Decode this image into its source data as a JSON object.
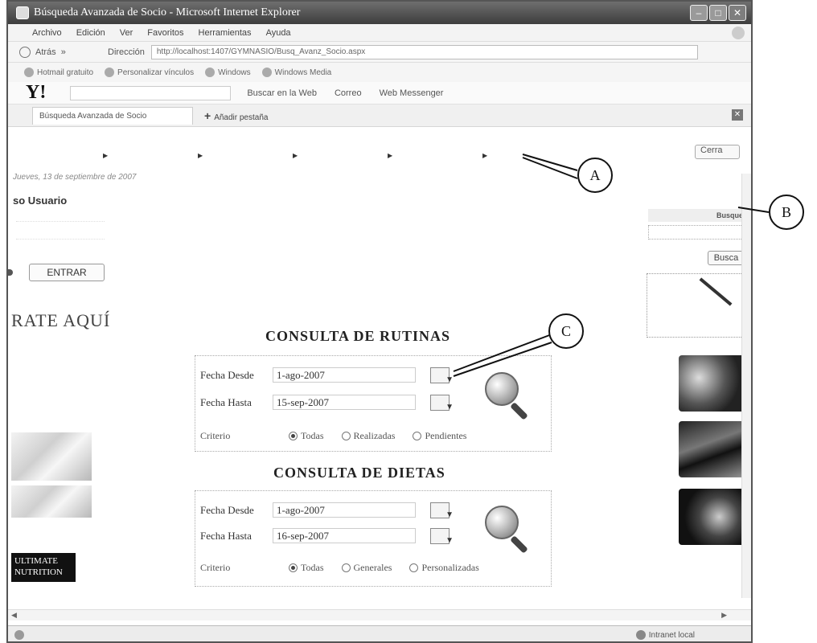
{
  "window": {
    "title": "Búsqueda Avanzada de Socio - Microsoft Internet Explorer"
  },
  "menu": [
    "Archivo",
    "Edición",
    "Ver",
    "Favoritos",
    "Herramientas",
    "Ayuda"
  ],
  "address": {
    "back_label": "Atrás",
    "address_label": "Dirección",
    "url": "http://localhost:1407/GYMNASIO/Busq_Avanz_Socio.aspx"
  },
  "links": [
    "Hotmail gratuito",
    "Personalizar vínculos",
    "Windows",
    "Windows Media"
  ],
  "yahoo_toolbar": {
    "logo": "Y!",
    "search_web": "Buscar en la Web",
    "mail": "Correo",
    "messenger": "Web Messenger"
  },
  "tabs": {
    "active_tab": "Búsqueda Avanzada de Socio",
    "new_tab": "Añadir pestaña"
  },
  "page": {
    "close_label": "Cerra",
    "date_text": "Jueves, 13 de septiembre de 2007",
    "user_title": "so Usuario",
    "login_button": "ENTRAR",
    "register_text": "RATE AQUÍ",
    "promo_dark_text": "ULTIMATE NUTRITION"
  },
  "consulta_rutinas": {
    "title": "CONSULTA DE RUTINAS",
    "fecha_desde_label": "Fecha Desde",
    "fecha_desde_value": "1-ago-2007",
    "fecha_hasta_label": "Fecha Hasta",
    "fecha_hasta_value": "15-sep-2007",
    "criterio_label": "Criterio",
    "options": [
      "Todas",
      "Realizadas",
      "Pendientes"
    ],
    "selected": "Todas"
  },
  "consulta_dietas": {
    "title": "CONSULTA DE DIETAS",
    "fecha_desde_label": "Fecha Desde",
    "fecha_desde_value": "1-ago-2007",
    "fecha_hasta_label": "Fecha Hasta",
    "fecha_hasta_value": "16-sep-2007",
    "criterio_label": "Criterio",
    "options": [
      "Todas",
      "Generales",
      "Personalizadas"
    ],
    "selected": "Todas"
  },
  "right_panel": {
    "search_header": "Busque",
    "search_button": "Busca"
  },
  "status": {
    "zone": "Intranet local"
  },
  "callouts": [
    "A",
    "B",
    "C"
  ],
  "colors": {
    "titlebar": "#4d4d4d",
    "panel_border": "#aaaaaa"
  }
}
